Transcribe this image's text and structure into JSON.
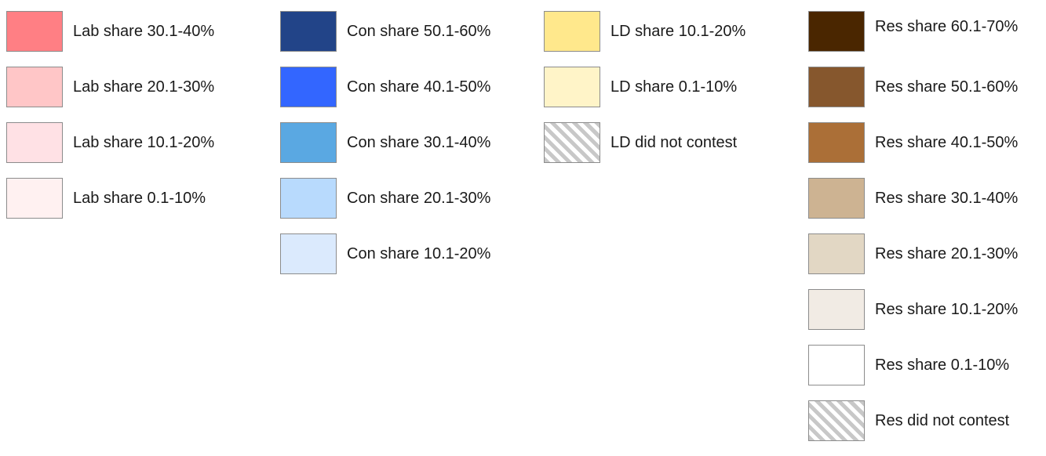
{
  "legend": {
    "lab": [
      {
        "label": "Lab share 30.1-40%",
        "color": "#ff7f84"
      },
      {
        "label": "Lab share 20.1-30%",
        "color": "#ffc6c7"
      },
      {
        "label": "Lab share 10.1-20%",
        "color": "#ffe1e5"
      },
      {
        "label": "Lab share 0.1-10%",
        "color": "#fff1f1"
      }
    ],
    "con": [
      {
        "label": "Con share 50.1-60%",
        "color": "#224488"
      },
      {
        "label": "Con share 40.1-50%",
        "color": "#3366ff"
      },
      {
        "label": "Con share 30.1-40%",
        "color": "#5aa8e2"
      },
      {
        "label": "Con share 20.1-30%",
        "color": "#b8dafd"
      },
      {
        "label": "Con share 10.1-20%",
        "color": "#dbeafd"
      }
    ],
    "ld": [
      {
        "label": "LD share 10.1-20%",
        "color": "#ffe88c"
      },
      {
        "label": "LD share 0.1-10%",
        "color": "#fff4c8"
      },
      {
        "label": "LD did not contest",
        "pattern": "hatched"
      }
    ],
    "res": [
      {
        "label": "Res share 60.1-70%",
        "color": "#4a2600"
      },
      {
        "label": "Res share 50.1-60%",
        "color": "#86572d"
      },
      {
        "label": "Res share 40.1-50%",
        "color": "#ab6f37"
      },
      {
        "label": "Res share 30.1-40%",
        "color": "#cdb392"
      },
      {
        "label": "Res share 20.1-30%",
        "color": "#e2d7c4"
      },
      {
        "label": "Res share 10.1-20%",
        "color": "#f1ebe4"
      },
      {
        "label": "Res share 0.1-10%",
        "color": "#ffffff"
      },
      {
        "label": "Res did not contest",
        "pattern": "hatched"
      }
    ]
  }
}
